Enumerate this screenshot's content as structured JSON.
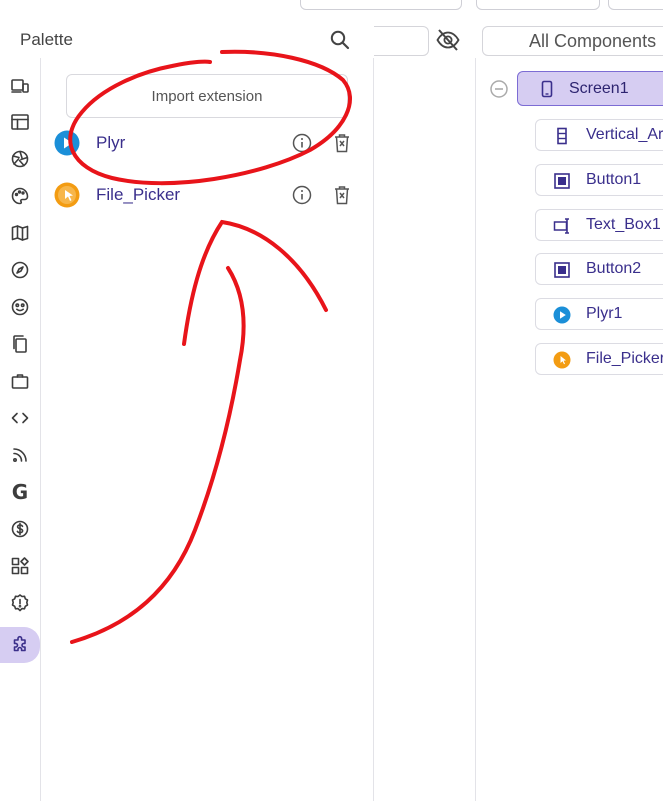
{
  "palette": {
    "title": "Palette",
    "search_icon": "search-icon",
    "import_label": "Import extension",
    "extensions": [
      {
        "name": "Plyr",
        "logo": "plyr-logo",
        "color": "#1b8fd8"
      },
      {
        "name": "File_Picker",
        "logo": "file-picker-logo",
        "color": "#f39c12"
      }
    ]
  },
  "rail": {
    "items": [
      "user-interface-icon",
      "layout-icon",
      "media-icon",
      "drawing-icon",
      "maps-icon",
      "sensors-icon",
      "social-icon",
      "storage-icon",
      "connectivity-icon",
      "lego-icon",
      "rss-icon",
      "google-icon",
      "monetization-icon",
      "widgets-icon",
      "experimental-icon",
      "extension-icon"
    ],
    "active": "extension-icon",
    "google_glyph": "G"
  },
  "components": {
    "filter_label": "All Components",
    "tree": [
      {
        "label": "Screen1",
        "icon": "phone-icon",
        "selected": true
      },
      {
        "label": "Vertical_Ar",
        "icon": "vertical-arrangement-icon"
      },
      {
        "label": "Button1",
        "icon": "button-icon"
      },
      {
        "label": "Text_Box1",
        "icon": "textbox-icon"
      },
      {
        "label": "Button2",
        "icon": "button-icon"
      },
      {
        "label": "Plyr1",
        "icon": "plyr-logo"
      },
      {
        "label": "File_Picker",
        "icon": "file-picker-logo"
      }
    ]
  },
  "colors": {
    "accent": "#3a2f8c",
    "selected_bg": "#d6cdf2",
    "annotation": "#e8141a"
  }
}
